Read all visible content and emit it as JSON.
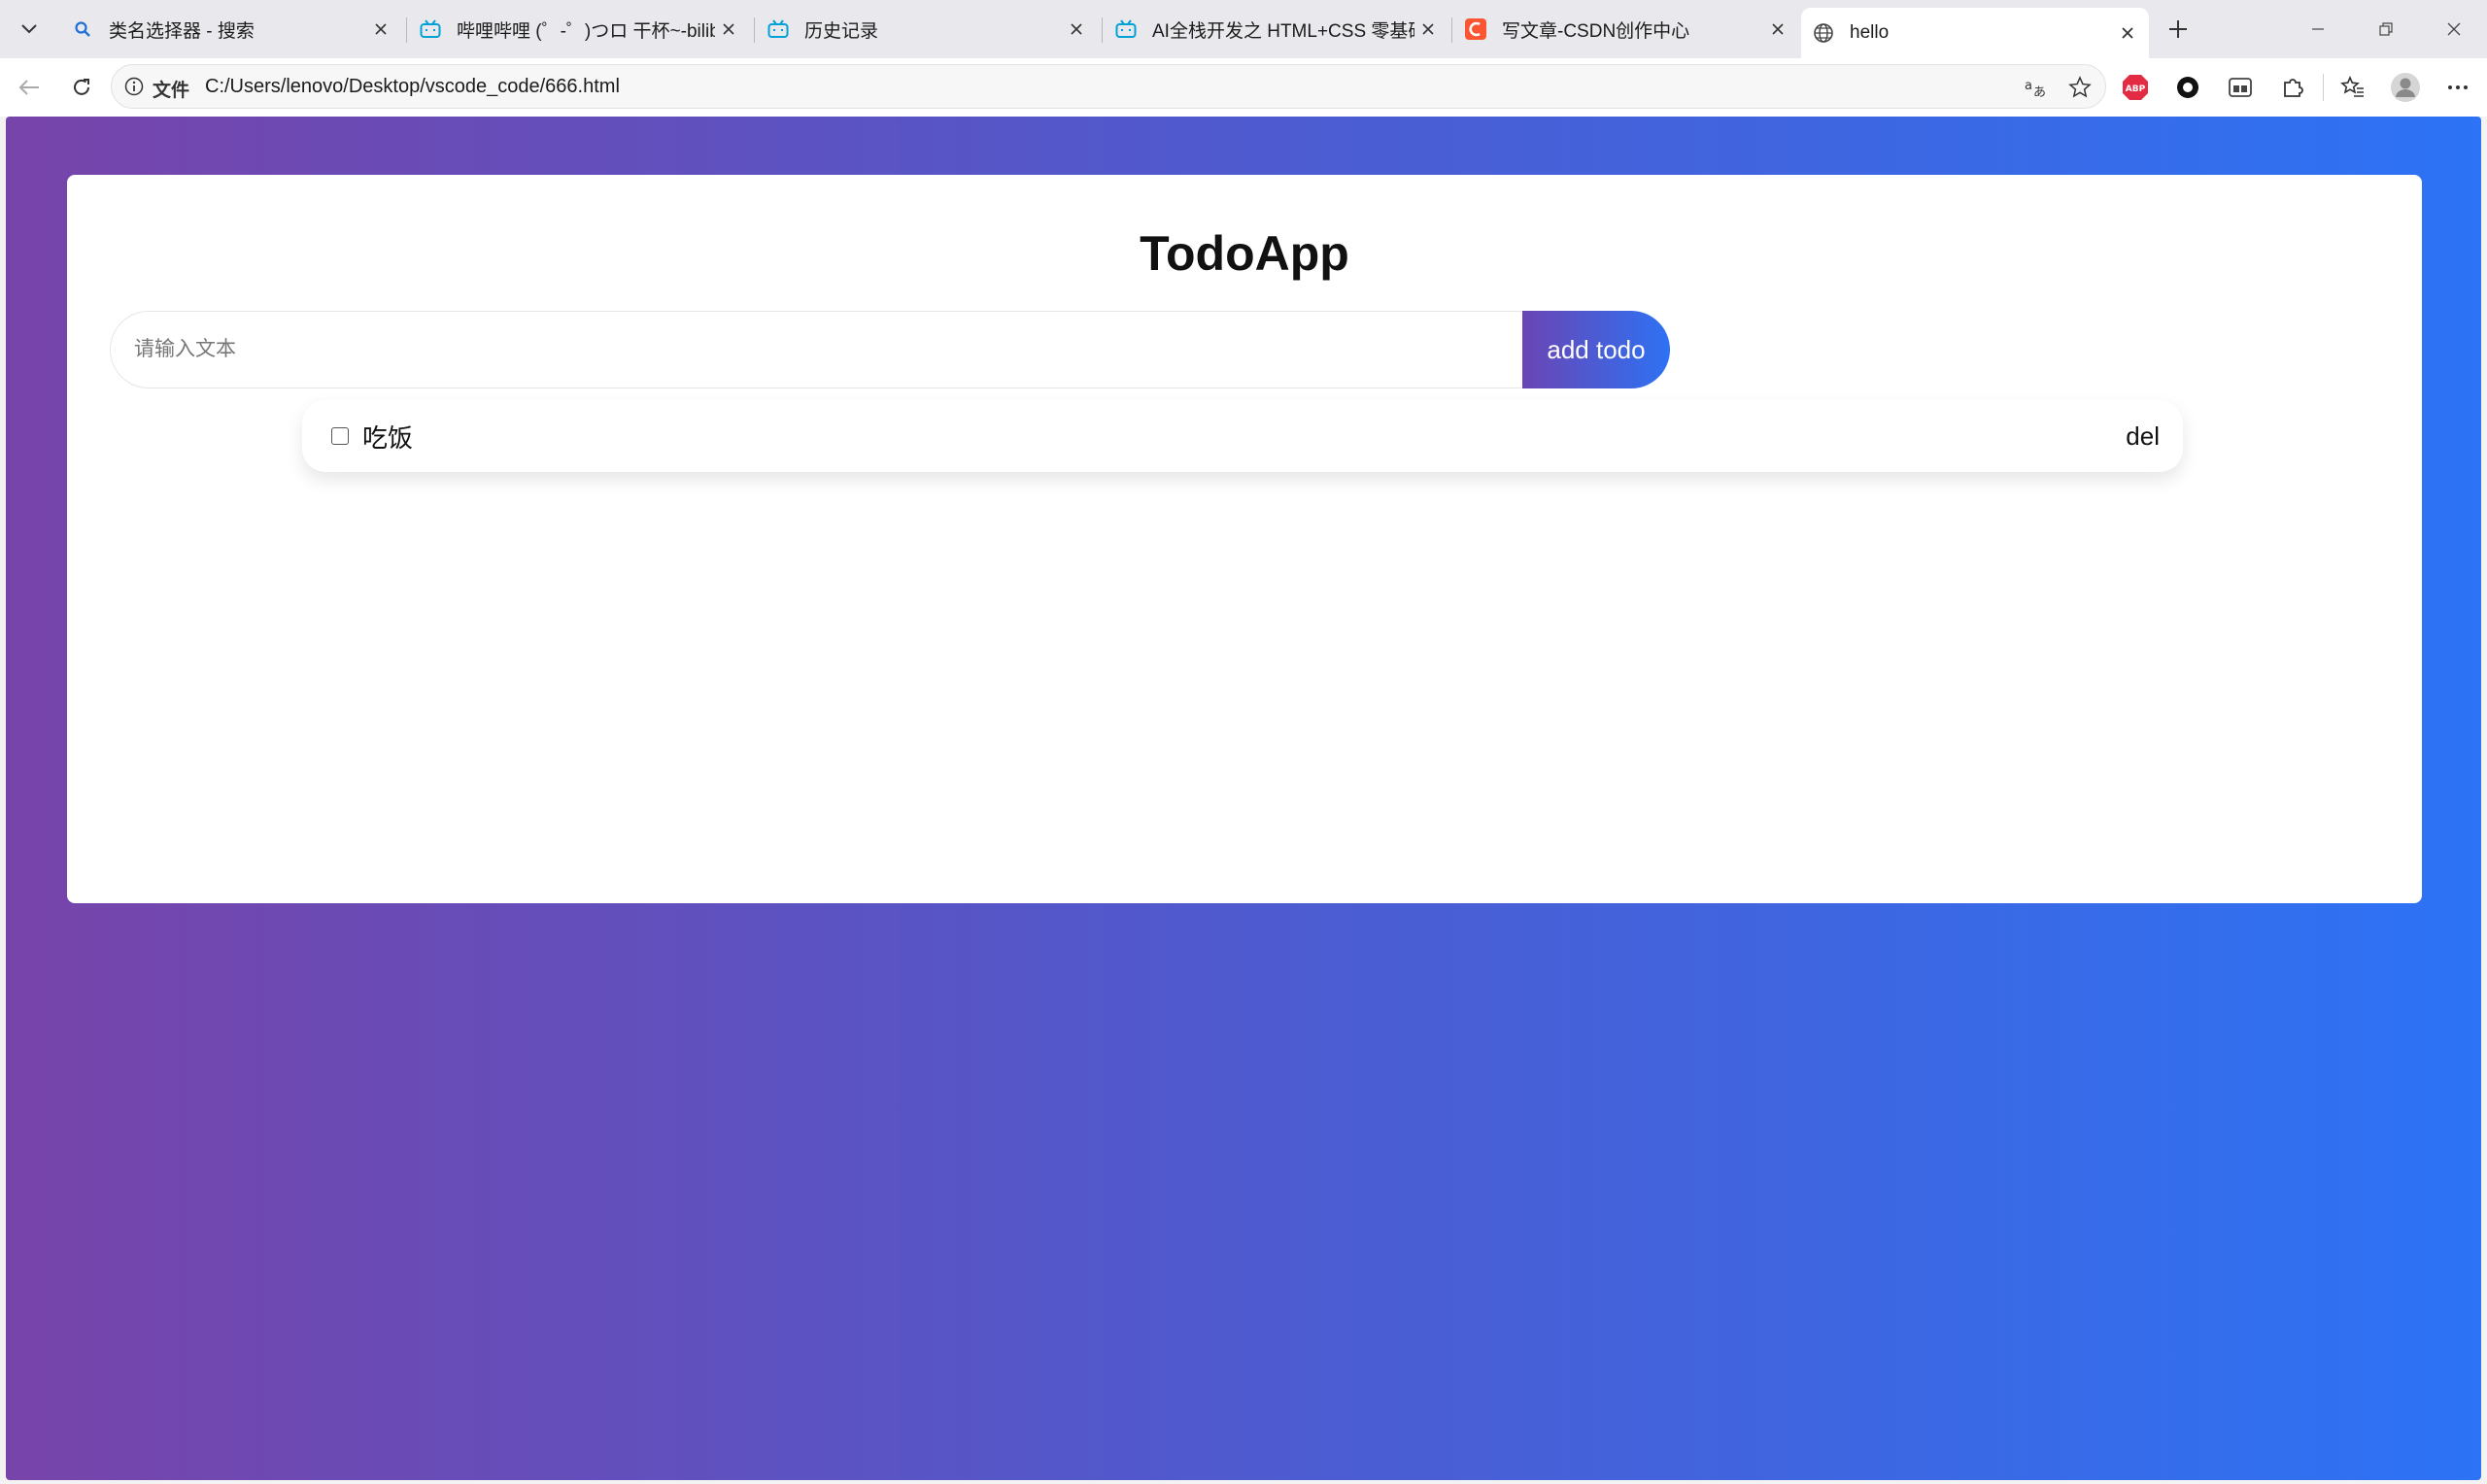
{
  "browser": {
    "tabs": [
      {
        "label": "类名选择器 - 搜索",
        "icon": "search-icon"
      },
      {
        "label": "哔哩哔哩 (゜-゜)つロ 干杯~-bilibili",
        "icon": "bilibili-icon"
      },
      {
        "label": "历史记录",
        "icon": "bilibili-icon"
      },
      {
        "label": "AI全栈开发之 HTML+CSS 零基础入门",
        "icon": "bilibili-icon"
      },
      {
        "label": "写文章-CSDN创作中心",
        "icon": "csdn-icon"
      },
      {
        "label": "hello",
        "icon": "globe-icon",
        "active": true
      }
    ],
    "address": {
      "scheme_label": "文件",
      "url": "C:/Users/lenovo/Desktop/vscode_code/666.html"
    },
    "extension_badge": "ABP",
    "colors": {
      "bilibili": "#00a1d6",
      "csdn": "#fc5531",
      "abp": "#e32b44"
    }
  },
  "app": {
    "title": "TodoApp",
    "input": {
      "placeholder": "请输入文本",
      "value": ""
    },
    "add_button": "add todo",
    "todos": [
      {
        "text": "吃饭",
        "done": false,
        "delete_label": "del"
      }
    ],
    "colors": {
      "gradient_start": "#7744aa",
      "gradient_end": "#2c73f5"
    }
  }
}
